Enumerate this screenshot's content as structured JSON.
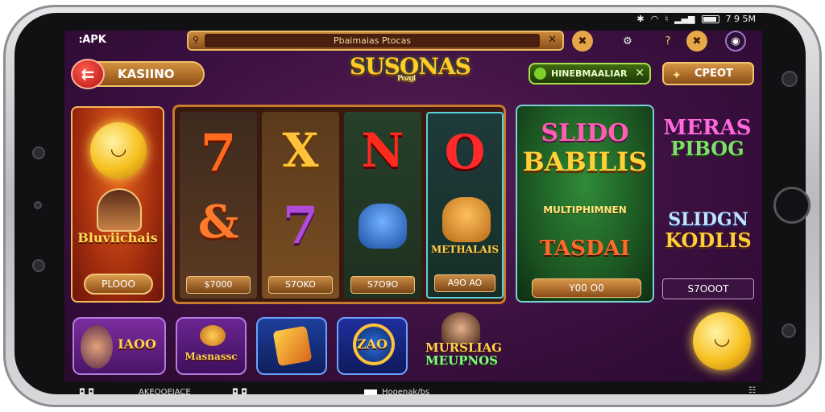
{
  "status": {
    "time": "7 9 5M"
  },
  "app": {
    "label": "ꓽAPK"
  },
  "search": {
    "placeholder": "Pbaimaias Ptocas"
  },
  "nav": {
    "back_label": "KASIINO",
    "logo": "SUSONAS",
    "logo_sub": "Pozgl",
    "promo_label": "HINEBMAALIAR",
    "cash_label": "CPEOT"
  },
  "left_card": {
    "title": "Bluviichais",
    "button": "PLOOO"
  },
  "slot": {
    "reels": [
      {
        "top": "7",
        "bottom": "&",
        "price": "$7000"
      },
      {
        "top": "X",
        "bottom": "7",
        "price": "S7OKO"
      },
      {
        "top": "N",
        "bottom": "",
        "price": "S7O9O"
      },
      {
        "top": "O",
        "bottom": "METHALAIS",
        "price": "A9O AO"
      }
    ]
  },
  "big_card": {
    "title_top": "SLIDO",
    "title_main": "BABILIS",
    "subtitle": "MULTIPHIMNEN",
    "title_bottom": "TASDAI",
    "button": "Y00 O0"
  },
  "right_column": {
    "title1_l1": "MERAS",
    "title1_l2": "PIBOG",
    "title2_l1": "SLIDGN",
    "title2_l2": "KODLIS",
    "button": "S7OOOT"
  },
  "tiles": [
    {
      "label": "IAOO"
    },
    {
      "label": "Masnassc"
    },
    {
      "label": ""
    },
    {
      "label": "ZAO"
    }
  ],
  "tile_text": {
    "l1": "MURSLIAG",
    "l2": "MEUPNOS"
  },
  "bottom_bar": {
    "left_text": "AKEOOEIACE",
    "center_text": "Hooenak/bs"
  }
}
